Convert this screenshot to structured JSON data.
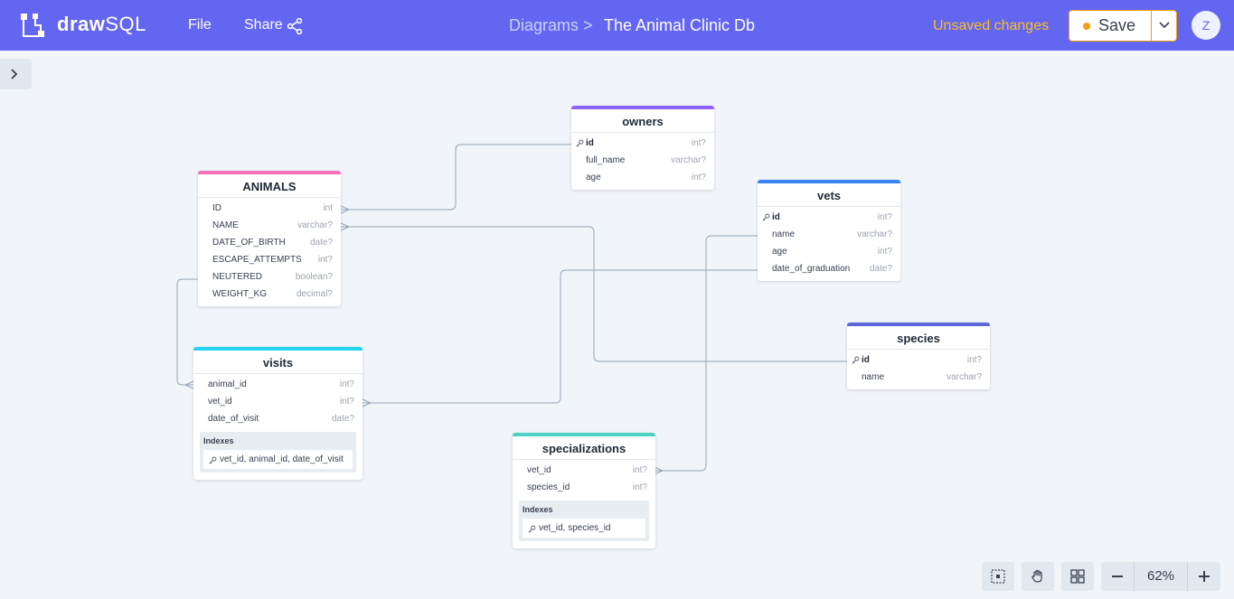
{
  "header": {
    "app_name_bold": "draw",
    "app_name_light": "SQL",
    "menu_file": "File",
    "menu_share": "Share",
    "breadcrumb": "Diagrams >",
    "diagram_title": "The Animal Clinic Db",
    "unsaved": "Unsaved changes",
    "save_label": "Save",
    "avatar_initial": "Z",
    "brand_color": "#6366f1",
    "warning_color": "#f59e0b"
  },
  "tables": {
    "animals": {
      "name": "ANIMALS",
      "color": "#f472b6",
      "columns": [
        {
          "name": "ID",
          "type": "int"
        },
        {
          "name": "NAME",
          "type": "varchar?"
        },
        {
          "name": "DATE_OF_BIRTH",
          "type": "date?"
        },
        {
          "name": "ESCAPE_ATTEMPTS",
          "type": "int?"
        },
        {
          "name": "NEUTERED",
          "type": "boolean?"
        },
        {
          "name": "WEIGHT_KG",
          "type": "decimal?"
        }
      ]
    },
    "owners": {
      "name": "owners",
      "color": "#9061f9",
      "columns": [
        {
          "name": "id",
          "type": "int?"
        },
        {
          "name": "full_name",
          "type": "varchar?"
        },
        {
          "name": "age",
          "type": "int?"
        }
      ]
    },
    "vets": {
      "name": "vets",
      "color": "#3b82f6",
      "columns": [
        {
          "name": "id",
          "type": "int?"
        },
        {
          "name": "name",
          "type": "varchar?"
        },
        {
          "name": "age",
          "type": "int?"
        },
        {
          "name": "date_of_graduation",
          "type": "date?"
        }
      ]
    },
    "species": {
      "name": "species",
      "color": "#5a67d8",
      "columns": [
        {
          "name": "id",
          "type": "int?"
        },
        {
          "name": "name",
          "type": "varchar?"
        }
      ]
    },
    "visits": {
      "name": "visits",
      "color": "#22d3ee",
      "columns": [
        {
          "name": "animal_id",
          "type": "int?"
        },
        {
          "name": "vet_id",
          "type": "int?"
        },
        {
          "name": "date_of_visit",
          "type": "date?"
        }
      ],
      "indexes_title": "Indexes",
      "index": "vet_id, animal_id, date_of_visit"
    },
    "specializations": {
      "name": "specializations",
      "color": "#4fd1c5",
      "columns": [
        {
          "name": "vet_id",
          "type": "int?"
        },
        {
          "name": "species_id",
          "type": "int?"
        }
      ],
      "indexes_title": "Indexes",
      "index": "vet_id, species_id"
    }
  },
  "toolbar": {
    "zoom": "62%",
    "icons": [
      "fit-view-icon",
      "pan-hand-icon",
      "grid-layout-icon",
      "zoom-out-icon",
      "zoom-in-icon"
    ]
  }
}
